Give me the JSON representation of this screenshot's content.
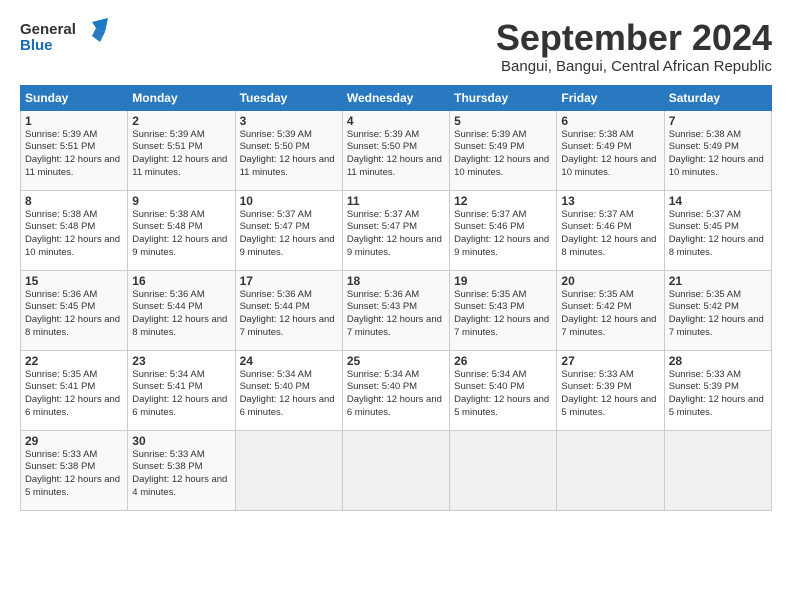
{
  "header": {
    "logo_line1": "General",
    "logo_line2": "Blue",
    "month_title": "September 2024",
    "location": "Bangui, Bangui, Central African Republic"
  },
  "calendar": {
    "headers": [
      "Sunday",
      "Monday",
      "Tuesday",
      "Wednesday",
      "Thursday",
      "Friday",
      "Saturday"
    ],
    "weeks": [
      [
        null,
        {
          "day": "2",
          "sunrise": "Sunrise: 5:39 AM",
          "sunset": "Sunset: 5:51 PM",
          "daylight": "Daylight: 12 hours and 11 minutes."
        },
        {
          "day": "3",
          "sunrise": "Sunrise: 5:39 AM",
          "sunset": "Sunset: 5:50 PM",
          "daylight": "Daylight: 12 hours and 11 minutes."
        },
        {
          "day": "4",
          "sunrise": "Sunrise: 5:39 AM",
          "sunset": "Sunset: 5:50 PM",
          "daylight": "Daylight: 12 hours and 11 minutes."
        },
        {
          "day": "5",
          "sunrise": "Sunrise: 5:39 AM",
          "sunset": "Sunset: 5:49 PM",
          "daylight": "Daylight: 12 hours and 10 minutes."
        },
        {
          "day": "6",
          "sunrise": "Sunrise: 5:38 AM",
          "sunset": "Sunset: 5:49 PM",
          "daylight": "Daylight: 12 hours and 10 minutes."
        },
        {
          "day": "7",
          "sunrise": "Sunrise: 5:38 AM",
          "sunset": "Sunset: 5:49 PM",
          "daylight": "Daylight: 12 hours and 10 minutes."
        }
      ],
      [
        {
          "day": "1",
          "sunrise": "Sunrise: 5:39 AM",
          "sunset": "Sunset: 5:51 PM",
          "daylight": "Daylight: 12 hours and 11 minutes."
        },
        {
          "day": "9",
          "sunrise": "Sunrise: 5:38 AM",
          "sunset": "Sunset: 5:48 PM",
          "daylight": "Daylight: 12 hours and 9 minutes."
        },
        {
          "day": "10",
          "sunrise": "Sunrise: 5:37 AM",
          "sunset": "Sunset: 5:47 PM",
          "daylight": "Daylight: 12 hours and 9 minutes."
        },
        {
          "day": "11",
          "sunrise": "Sunrise: 5:37 AM",
          "sunset": "Sunset: 5:47 PM",
          "daylight": "Daylight: 12 hours and 9 minutes."
        },
        {
          "day": "12",
          "sunrise": "Sunrise: 5:37 AM",
          "sunset": "Sunset: 5:46 PM",
          "daylight": "Daylight: 12 hours and 9 minutes."
        },
        {
          "day": "13",
          "sunrise": "Sunrise: 5:37 AM",
          "sunset": "Sunset: 5:46 PM",
          "daylight": "Daylight: 12 hours and 8 minutes."
        },
        {
          "day": "14",
          "sunrise": "Sunrise: 5:37 AM",
          "sunset": "Sunset: 5:45 PM",
          "daylight": "Daylight: 12 hours and 8 minutes."
        }
      ],
      [
        {
          "day": "8",
          "sunrise": "Sunrise: 5:38 AM",
          "sunset": "Sunset: 5:48 PM",
          "daylight": "Daylight: 12 hours and 10 minutes."
        },
        {
          "day": "16",
          "sunrise": "Sunrise: 5:36 AM",
          "sunset": "Sunset: 5:44 PM",
          "daylight": "Daylight: 12 hours and 8 minutes."
        },
        {
          "day": "17",
          "sunrise": "Sunrise: 5:36 AM",
          "sunset": "Sunset: 5:44 PM",
          "daylight": "Daylight: 12 hours and 7 minutes."
        },
        {
          "day": "18",
          "sunrise": "Sunrise: 5:36 AM",
          "sunset": "Sunset: 5:43 PM",
          "daylight": "Daylight: 12 hours and 7 minutes."
        },
        {
          "day": "19",
          "sunrise": "Sunrise: 5:35 AM",
          "sunset": "Sunset: 5:43 PM",
          "daylight": "Daylight: 12 hours and 7 minutes."
        },
        {
          "day": "20",
          "sunrise": "Sunrise: 5:35 AM",
          "sunset": "Sunset: 5:42 PM",
          "daylight": "Daylight: 12 hours and 7 minutes."
        },
        {
          "day": "21",
          "sunrise": "Sunrise: 5:35 AM",
          "sunset": "Sunset: 5:42 PM",
          "daylight": "Daylight: 12 hours and 7 minutes."
        }
      ],
      [
        {
          "day": "15",
          "sunrise": "Sunrise: 5:36 AM",
          "sunset": "Sunset: 5:45 PM",
          "daylight": "Daylight: 12 hours and 8 minutes."
        },
        {
          "day": "23",
          "sunrise": "Sunrise: 5:34 AM",
          "sunset": "Sunset: 5:41 PM",
          "daylight": "Daylight: 12 hours and 6 minutes."
        },
        {
          "day": "24",
          "sunrise": "Sunrise: 5:34 AM",
          "sunset": "Sunset: 5:40 PM",
          "daylight": "Daylight: 12 hours and 6 minutes."
        },
        {
          "day": "25",
          "sunrise": "Sunrise: 5:34 AM",
          "sunset": "Sunset: 5:40 PM",
          "daylight": "Daylight: 12 hours and 6 minutes."
        },
        {
          "day": "26",
          "sunrise": "Sunrise: 5:34 AM",
          "sunset": "Sunset: 5:40 PM",
          "daylight": "Daylight: 12 hours and 5 minutes."
        },
        {
          "day": "27",
          "sunrise": "Sunrise: 5:33 AM",
          "sunset": "Sunset: 5:39 PM",
          "daylight": "Daylight: 12 hours and 5 minutes."
        },
        {
          "day": "28",
          "sunrise": "Sunrise: 5:33 AM",
          "sunset": "Sunset: 5:39 PM",
          "daylight": "Daylight: 12 hours and 5 minutes."
        }
      ],
      [
        {
          "day": "22",
          "sunrise": "Sunrise: 5:35 AM",
          "sunset": "Sunset: 5:41 PM",
          "daylight": "Daylight: 12 hours and 6 minutes."
        },
        {
          "day": "30",
          "sunrise": "Sunrise: 5:33 AM",
          "sunset": "Sunset: 5:38 PM",
          "daylight": "Daylight: 12 hours and 4 minutes."
        },
        null,
        null,
        null,
        null,
        null
      ],
      [
        {
          "day": "29",
          "sunrise": "Sunrise: 5:33 AM",
          "sunset": "Sunset: 5:38 PM",
          "daylight": "Daylight: 12 hours and 5 minutes."
        }
      ]
    ]
  }
}
